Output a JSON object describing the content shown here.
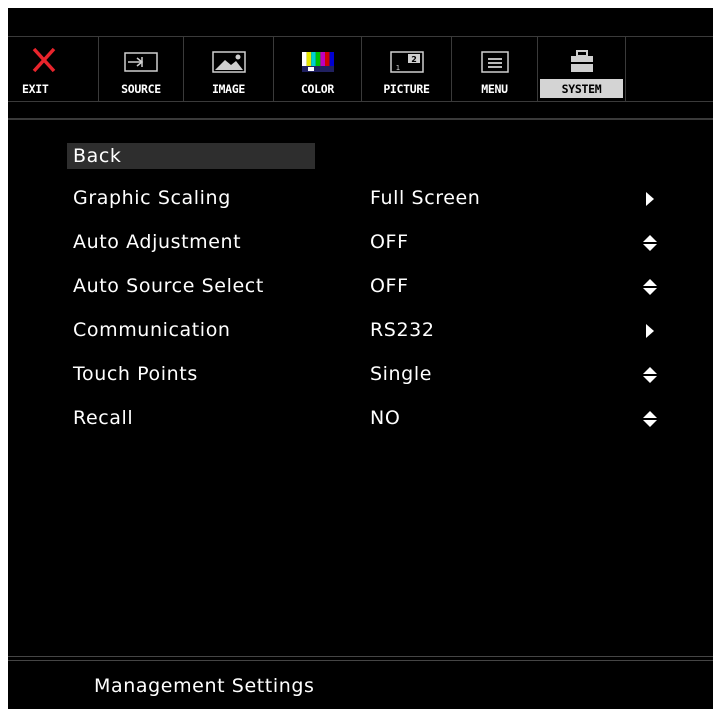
{
  "tabs": [
    {
      "label": "EXIT",
      "icon": "close-icon",
      "active": false
    },
    {
      "label": "SOURCE",
      "icon": "source-input-icon",
      "active": false
    },
    {
      "label": "IMAGE",
      "icon": "image-icon",
      "active": false
    },
    {
      "label": "COLOR",
      "icon": "color-bars-icon",
      "active": false
    },
    {
      "label": "PICTURE",
      "icon": "picture-in-picture-icon",
      "active": false
    },
    {
      "label": "MENU",
      "icon": "menu-icon",
      "active": false
    },
    {
      "label": "SYSTEM",
      "icon": "toolbox-icon",
      "active": true
    }
  ],
  "menu": {
    "back_label": "Back",
    "items": [
      {
        "label": "Graphic Scaling",
        "value": "Full Screen",
        "control": "arrow-right-icon"
      },
      {
        "label": "Auto Adjustment",
        "value": "OFF",
        "control": "up-down-arrow-icon"
      },
      {
        "label": "Auto Source Select",
        "value": "OFF",
        "control": "up-down-arrow-icon"
      },
      {
        "label": "Communication",
        "value": "RS232",
        "control": "arrow-right-icon"
      },
      {
        "label": "Touch Points",
        "value": "Single",
        "control": "up-down-arrow-icon"
      },
      {
        "label": "Recall",
        "value": "NO",
        "control": "up-down-arrow-icon"
      }
    ]
  },
  "footer": {
    "title": "Management Settings"
  },
  "colors": {
    "background": "#000000",
    "text": "#ffffff",
    "exit_icon": "#e8242c",
    "active_tab": "#d4d4d4"
  }
}
